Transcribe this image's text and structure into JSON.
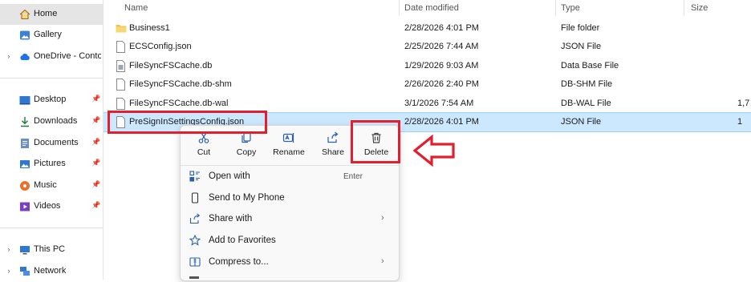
{
  "sidebar": {
    "items": [
      {
        "label": "Home",
        "icon": "home-icon",
        "chevron": false,
        "pin": false
      },
      {
        "label": "Gallery",
        "icon": "gallery-icon",
        "chevron": false,
        "pin": false
      },
      {
        "label": "OneDrive - Contoso",
        "icon": "cloud-icon",
        "chevron": true,
        "pin": false
      },
      {
        "label": "Desktop",
        "icon": "desktop-icon",
        "chevron": false,
        "pin": true
      },
      {
        "label": "Downloads",
        "icon": "download-icon",
        "chevron": false,
        "pin": true
      },
      {
        "label": "Documents",
        "icon": "documents-icon",
        "chevron": false,
        "pin": true
      },
      {
        "label": "Pictures",
        "icon": "pictures-icon",
        "chevron": false,
        "pin": true
      },
      {
        "label": "Music",
        "icon": "music-icon",
        "chevron": false,
        "pin": true
      },
      {
        "label": "Videos",
        "icon": "videos-icon",
        "chevron": false,
        "pin": true
      },
      {
        "label": "This PC",
        "icon": "computer-icon",
        "chevron": true,
        "pin": false
      },
      {
        "label": "Network",
        "icon": "network-icon",
        "chevron": true,
        "pin": false
      }
    ],
    "chevron_glyph": "›",
    "pin_glyph": "📌"
  },
  "columns": {
    "name": "Name",
    "date": "Date modified",
    "type": "Type",
    "size": "Size"
  },
  "files": [
    {
      "name": "Business1",
      "date": "2/28/2026 4:01 PM",
      "type": "File folder",
      "size": "",
      "icon": "folder-icon"
    },
    {
      "name": "ECSConfig.json",
      "date": "2/25/2026 7:44 AM",
      "type": "JSON File",
      "size": "",
      "icon": "file-icon"
    },
    {
      "name": "FileSyncFSCache.db",
      "date": "1/29/2026 9:03 AM",
      "type": "Data Base File",
      "size": "",
      "icon": "database-file-icon"
    },
    {
      "name": "FileSyncFSCache.db-shm",
      "date": "2/26/2026 2:40 PM",
      "type": "DB-SHM File",
      "size": "",
      "icon": "file-icon"
    },
    {
      "name": "FileSyncFSCache.db-wal",
      "date": "3/1/2026 7:54 AM",
      "type": "DB-WAL File",
      "size": "1,7",
      "icon": "file-icon"
    },
    {
      "name": "PreSignInSettingsConfig.json",
      "date": "2/28/2026 4:01 PM",
      "type": "JSON File",
      "size": "1",
      "icon": "file-icon"
    }
  ],
  "context_menu": {
    "quick_actions": [
      {
        "label": "Cut",
        "icon": "cut-icon"
      },
      {
        "label": "Copy",
        "icon": "copy-icon"
      },
      {
        "label": "Rename",
        "icon": "rename-icon"
      },
      {
        "label": "Share",
        "icon": "share-icon"
      },
      {
        "label": "Delete",
        "icon": "trash-icon"
      }
    ],
    "items": [
      {
        "label": "Open with",
        "shortcut": "Enter",
        "arrow": false,
        "icon": "open-with-icon"
      },
      {
        "label": "Send to My Phone",
        "shortcut": "",
        "arrow": false,
        "icon": "phone-icon"
      },
      {
        "label": "Share with",
        "shortcut": "",
        "arrow": true,
        "icon": "share-with-icon"
      },
      {
        "label": "Add to Favorites",
        "shortcut": "",
        "arrow": false,
        "icon": "star-icon"
      },
      {
        "label": "Compress to...",
        "shortcut": "",
        "arrow": true,
        "icon": "compress-icon"
      }
    ],
    "arrow_glyph": "›"
  },
  "annotation": {
    "color": "#e0202e"
  },
  "colors": {
    "selection": "#cce8ff",
    "folder": "#f0c24a",
    "accent": "#2b5faf"
  }
}
